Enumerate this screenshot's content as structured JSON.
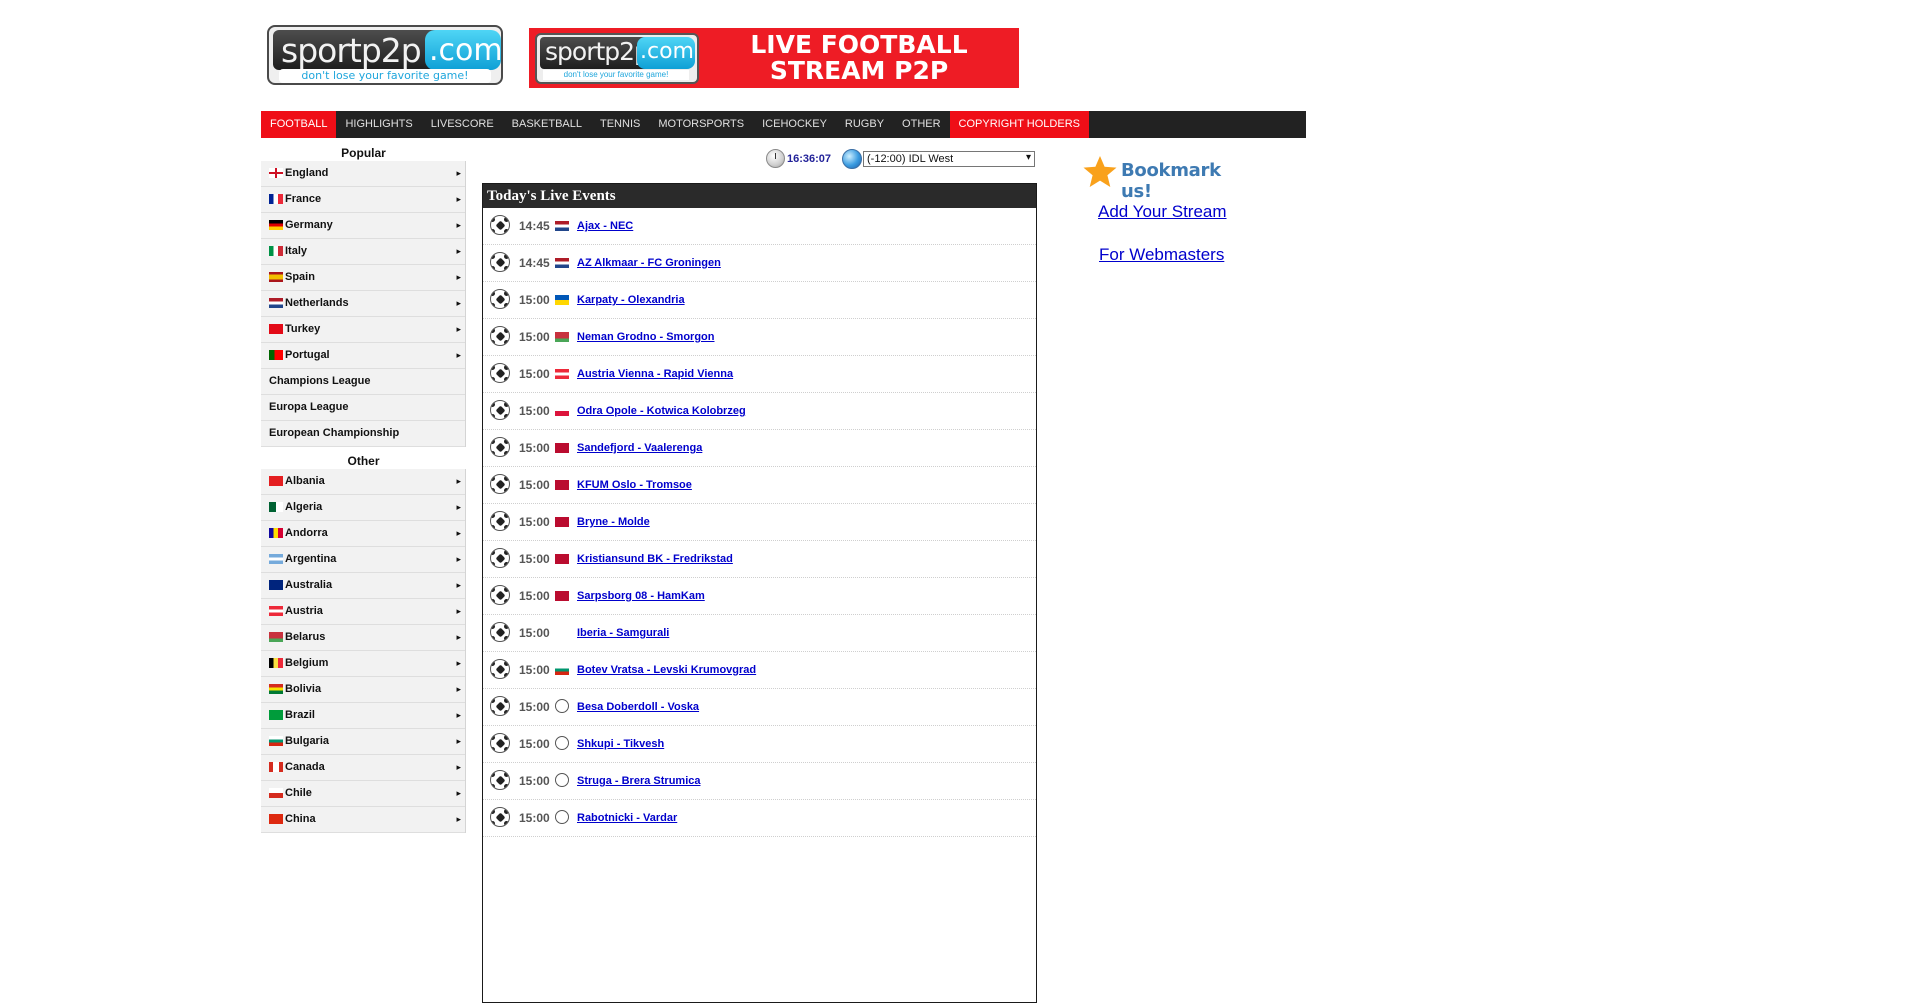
{
  "header": {
    "logo": {
      "left": "sportp2p",
      "right": ".com",
      "tagline": "don't lose your favorite game!"
    },
    "banner": {
      "logo_left": "sportp2p",
      "logo_right": ".com",
      "logo_tagline": "don't lose your favorite game!",
      "line1": "LIVE FOOTBALL",
      "line2": "STREAM P2P"
    }
  },
  "nav": [
    {
      "label": "FOOTBALL",
      "highlight": true
    },
    {
      "label": "HIGHLIGHTS",
      "highlight": false
    },
    {
      "label": "LIVESCORE",
      "highlight": false
    },
    {
      "label": "BASKETBALL",
      "highlight": false
    },
    {
      "label": "TENNIS",
      "highlight": false
    },
    {
      "label": "MOTORSPORTS",
      "highlight": false
    },
    {
      "label": "ICEHOCKEY",
      "highlight": false
    },
    {
      "label": "RUGBY",
      "highlight": false
    },
    {
      "label": "OTHER",
      "highlight": false
    },
    {
      "label": "COPYRIGHT HOLDERS",
      "highlight": true
    }
  ],
  "sidebar": {
    "popular_title": "Popular",
    "popular": [
      {
        "label": "England",
        "flag": "eng",
        "arrow": true
      },
      {
        "label": "France",
        "flag": "fra",
        "arrow": true
      },
      {
        "label": "Germany",
        "flag": "ger",
        "arrow": true
      },
      {
        "label": "Italy",
        "flag": "ita",
        "arrow": true
      },
      {
        "label": "Spain",
        "flag": "esp",
        "arrow": true
      },
      {
        "label": "Netherlands",
        "flag": "ned",
        "arrow": true
      },
      {
        "label": "Turkey",
        "flag": "tur",
        "arrow": true
      },
      {
        "label": "Portugal",
        "flag": "por",
        "arrow": true
      },
      {
        "label": "Champions League",
        "flag": "",
        "arrow": false
      },
      {
        "label": "Europa League",
        "flag": "",
        "arrow": false
      },
      {
        "label": "European Championship",
        "flag": "",
        "arrow": false
      }
    ],
    "other_title": "Other",
    "other": [
      {
        "label": "Albania",
        "flag": "alb"
      },
      {
        "label": "Algeria",
        "flag": "alg"
      },
      {
        "label": "Andorra",
        "flag": "and"
      },
      {
        "label": "Argentina",
        "flag": "arg"
      },
      {
        "label": "Australia",
        "flag": "aus"
      },
      {
        "label": "Austria",
        "flag": "aut"
      },
      {
        "label": "Belarus",
        "flag": "blr2"
      },
      {
        "label": "Belgium",
        "flag": "bel"
      },
      {
        "label": "Bolivia",
        "flag": "bol"
      },
      {
        "label": "Brazil",
        "flag": "bra"
      },
      {
        "label": "Bulgaria",
        "flag": "bul"
      },
      {
        "label": "Canada",
        "flag": "can"
      },
      {
        "label": "Chile",
        "flag": "chi"
      },
      {
        "label": "China",
        "flag": "chn"
      }
    ],
    "arrow_glyph": "▸"
  },
  "clock": {
    "time": "16:36:07",
    "timezone": "(-12:00) IDL West",
    "dropdown_glyph": "▾"
  },
  "events": {
    "title": "Today's Live Events",
    "rows": [
      {
        "time": "14:45",
        "flag": "ned",
        "match": "Ajax - NEC"
      },
      {
        "time": "14:45",
        "flag": "ned",
        "match": "AZ Alkmaar - FC Groningen"
      },
      {
        "time": "15:00",
        "flag": "ukr",
        "match": "Karpaty - Olexandria"
      },
      {
        "time": "15:00",
        "flag": "blr2",
        "match": "Neman Grodno - Smorgon"
      },
      {
        "time": "15:00",
        "flag": "aut",
        "match": "Austria Vienna - Rapid Vienna"
      },
      {
        "time": "15:00",
        "flag": "pol",
        "match": "Odra Opole - Kotwica Kolobrzeg"
      },
      {
        "time": "15:00",
        "flag": "nor",
        "match": "Sandefjord - Vaalerenga"
      },
      {
        "time": "15:00",
        "flag": "nor",
        "match": "KFUM Oslo - Tromsoe"
      },
      {
        "time": "15:00",
        "flag": "nor",
        "match": "Bryne - Molde"
      },
      {
        "time": "15:00",
        "flag": "nor",
        "match": "Kristiansund BK - Fredrikstad"
      },
      {
        "time": "15:00",
        "flag": "nor",
        "match": "Sarpsborg 08 - HamKam"
      },
      {
        "time": "15:00",
        "flag": "geo",
        "match": "Iberia - Samgurali"
      },
      {
        "time": "15:00",
        "flag": "bul",
        "match": "Botev Vratsa - Levski Krumovgrad"
      },
      {
        "time": "15:00",
        "flag": "worldball",
        "match": "Besa Doberdoll - Voska"
      },
      {
        "time": "15:00",
        "flag": "worldball",
        "match": "Shkupi - Tikvesh"
      },
      {
        "time": "15:00",
        "flag": "worldball",
        "match": "Struga - Brera Strumica"
      },
      {
        "time": "15:00",
        "flag": "worldball",
        "match": "Rabotnicki - Vardar"
      }
    ]
  },
  "right": {
    "bookmark": "Bookmark us!",
    "add_stream": "Add Your Stream",
    "webmasters": "For Webmasters"
  },
  "colors": {
    "accent_red": "#ef0e17",
    "nav_bg": "#222222",
    "link_blue": "#0000cc",
    "bookmark_blue": "#3e7ab2",
    "star": "#f9a11b"
  }
}
